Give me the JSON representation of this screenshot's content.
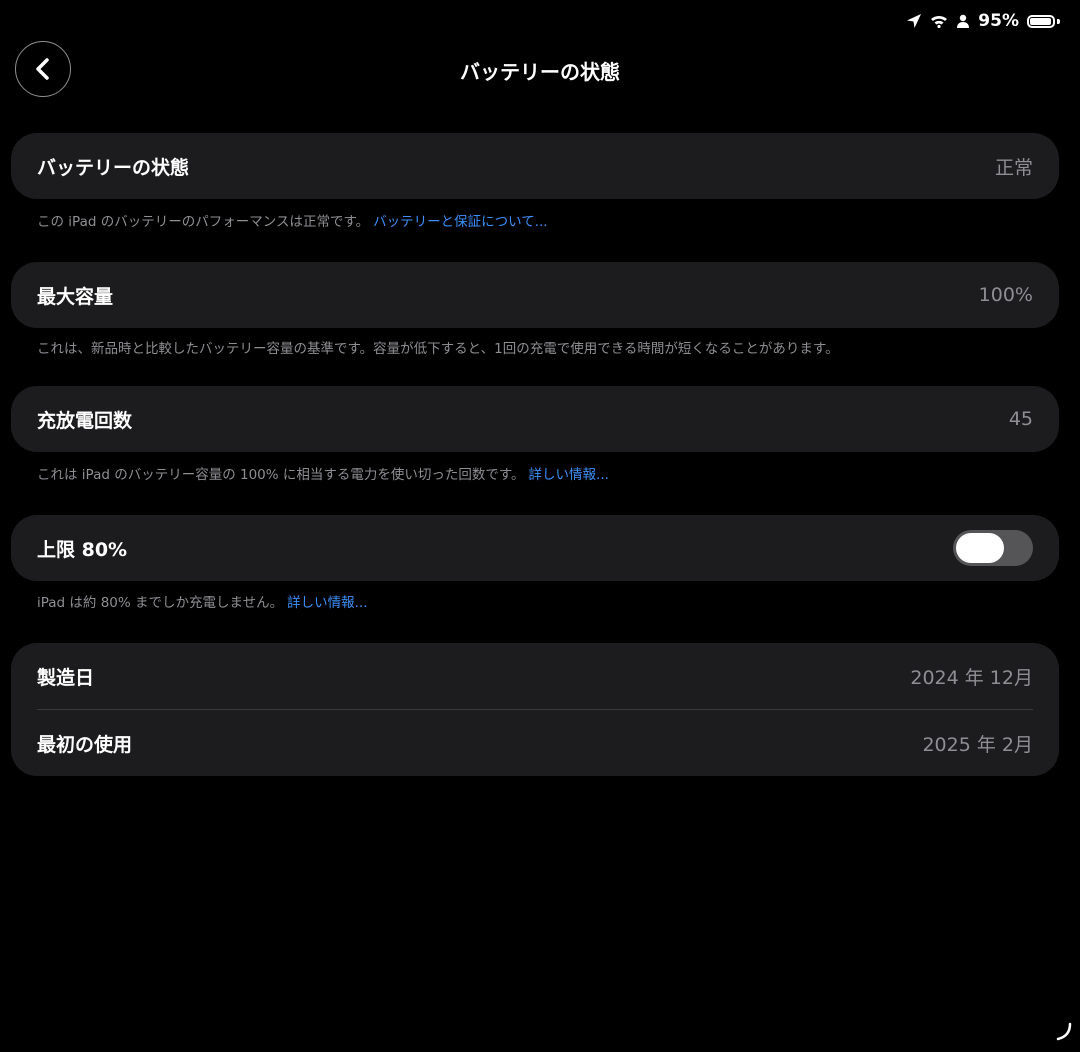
{
  "status_bar": {
    "battery_percent": "95%",
    "battery_level": 0.95
  },
  "nav": {
    "title": "バッテリーの状態"
  },
  "sections": {
    "health": {
      "label": "バッテリーの状態",
      "value": "正常",
      "footnote": "この iPad のバッテリーのパフォーマンスは正常です。",
      "link": "バッテリーと保証について..."
    },
    "max_capacity": {
      "label": "最大容量",
      "value": "100%",
      "footnote": "これは、新品時と比較したバッテリー容量の基準です。容量が低下すると、1回の充電で使用できる時間が短くなることがあります。"
    },
    "cycle_count": {
      "label": "充放電回数",
      "value": "45",
      "footnote": "これは iPad のバッテリー容量の 100% に相当する電力を使い切った回数です。",
      "link": "詳しい情報..."
    },
    "limit_80": {
      "label": "上限 80%",
      "toggle_on": false,
      "footnote": "iPad は約 80% までしか充電しません。",
      "link": "詳しい情報..."
    },
    "dates": {
      "manufacture_label": "製造日",
      "manufacture_value": "2024 年 12月",
      "first_use_label": "最初の使用",
      "first_use_value": "2025 年 2月"
    }
  },
  "colors": {
    "background": "#000000",
    "cell": "#1c1c1e",
    "secondary_text": "#8e8e93",
    "link": "#3e8ff7",
    "toggle_off": "#555558"
  },
  "icons": [
    "location-arrow-icon",
    "wifi-icon",
    "person-icon",
    "battery-icon",
    "chevron-left-icon"
  ]
}
